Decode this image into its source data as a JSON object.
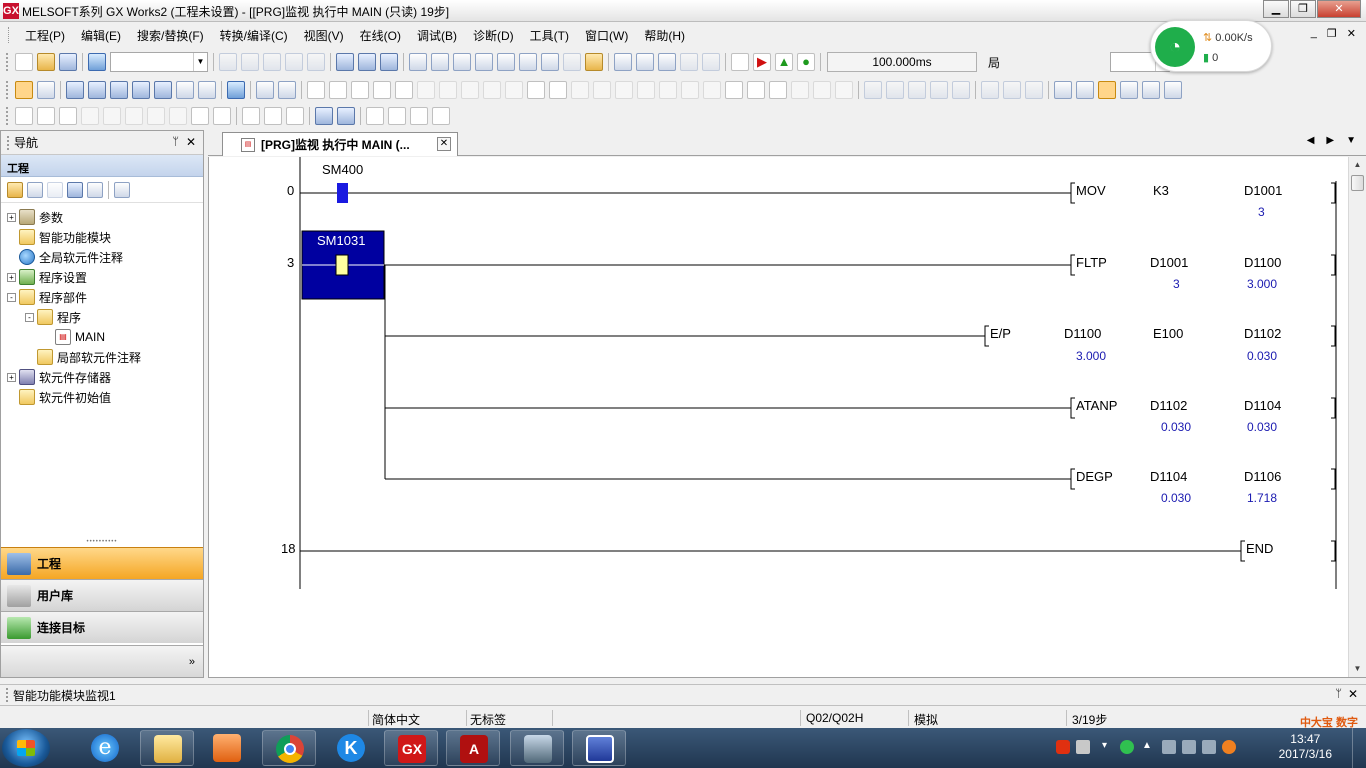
{
  "window": {
    "title": "MELSOFT系列 GX Works2 (工程未设置) - [[PRG]监视 执行中 MAIN (只读) 19步]",
    "app_icon": "GX"
  },
  "menu": [
    "工程(P)",
    "编辑(E)",
    "搜索/替换(F)",
    "转换/编译(C)",
    "视图(V)",
    "在线(O)",
    "调试(B)",
    "诊断(D)",
    "工具(T)",
    "窗口(W)",
    "帮助(H)"
  ],
  "toolbar": {
    "scan_time": "100.000ms",
    "partial_label": "局"
  },
  "network_widget": {
    "speed": "0.00K/s",
    "count": "0"
  },
  "navigation": {
    "title": "导航",
    "section": "工程",
    "tree": [
      {
        "label": "参数",
        "icon": "param",
        "level": 0,
        "expander": "+"
      },
      {
        "label": "智能功能模块",
        "icon": "folder",
        "level": 0,
        "expander": ""
      },
      {
        "label": "全局软元件注释",
        "icon": "globe",
        "level": 0,
        "expander": ""
      },
      {
        "label": "程序设置",
        "icon": "prog",
        "level": 0,
        "expander": "+"
      },
      {
        "label": "程序部件",
        "icon": "folder",
        "level": 0,
        "expander": "-"
      },
      {
        "label": "程序",
        "icon": "folder",
        "level": 1,
        "expander": "-"
      },
      {
        "label": "MAIN",
        "icon": "doc",
        "level": 2,
        "expander": ""
      },
      {
        "label": "局部软元件注释",
        "icon": "folder",
        "level": 1,
        "expander": ""
      },
      {
        "label": "软元件存储器",
        "icon": "mem",
        "level": 0,
        "expander": "+"
      },
      {
        "label": "软元件初始值",
        "icon": "folder",
        "level": 0,
        "expander": ""
      }
    ],
    "bottom_buttons": [
      "工程",
      "用户库",
      "连接目标"
    ],
    "more": "»"
  },
  "tab": {
    "label": "[PRG]监视 执行中 MAIN (..."
  },
  "ladder": {
    "step_numbers": [
      "0",
      "3",
      "18"
    ],
    "contacts": [
      "SM400",
      "SM1031"
    ],
    "instructions": [
      {
        "op": "MOV",
        "arg1": "K3",
        "arg2": "D1001",
        "val1": "",
        "val2": "3"
      },
      {
        "op": "FLTP",
        "arg1": "D1001",
        "arg2": "D1100",
        "val1": "3",
        "val2": "3.000"
      },
      {
        "op": "E/P",
        "arg1": "D1100",
        "arg2": "E100",
        "arg3": "D1102",
        "val1": "3.000",
        "val3": "0.030"
      },
      {
        "op": "ATANP",
        "arg1": "D1102",
        "arg2": "D1104",
        "val1": "0.030",
        "val2": "0.030"
      },
      {
        "op": "DEGP",
        "arg1": "D1104",
        "arg2": "D1106",
        "val1": "0.030",
        "val2": "1.718"
      }
    ],
    "end": "END"
  },
  "bottom_panel": {
    "title": "智能功能模块监视1"
  },
  "status": {
    "language": "简体中文",
    "label": "无标签",
    "cpu": "Q02/Q02H",
    "mode": "模拟",
    "steps": "3/19步"
  },
  "taskbar": {
    "date": "2017/3/16",
    "time": "13:47",
    "ie_glyph": "e",
    "k_glyph": "K",
    "gx_glyph": "GX",
    "pdf_glyph": "A"
  },
  "watermark": "中大宝 数字"
}
